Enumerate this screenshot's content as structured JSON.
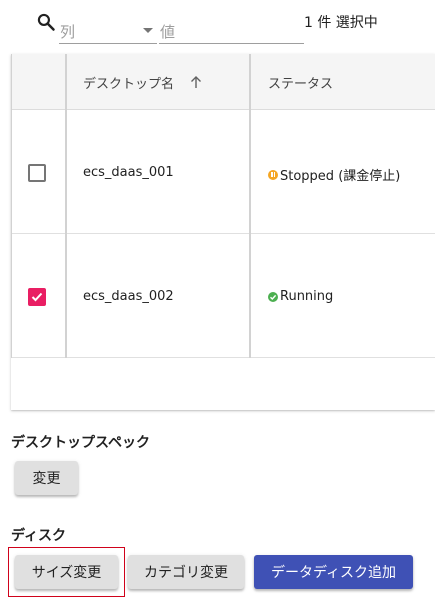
{
  "filter": {
    "column_placeholder": "列",
    "value_placeholder": "値",
    "selection_count": "1 件 選択中"
  },
  "grid": {
    "columns": [
      "デスクトップ名",
      "ステータス"
    ],
    "rows": [
      {
        "name": "ecs_daas_001",
        "status": "Stopped (課金停止)",
        "status_color": "#f5a623",
        "checked": false
      },
      {
        "name": "ecs_daas_002",
        "status": "Running",
        "status_color": "#4caf50",
        "checked": true
      }
    ]
  },
  "desktop_spec": {
    "title": "デスクトップスペック",
    "change_label": "変更"
  },
  "disk": {
    "title": "ディスク",
    "resize_label": "サイズ変更",
    "category_label": "カテゴリ変更",
    "add_data_disk_label": "データディスク追加"
  },
  "colors": {
    "accent_pink": "#e91e63",
    "primary_blue": "#3f51b5",
    "highlight_red": "#d0021b"
  }
}
